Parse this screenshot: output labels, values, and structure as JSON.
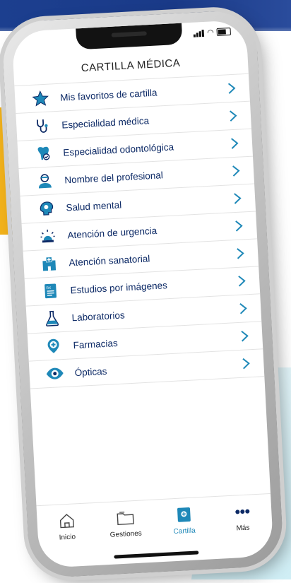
{
  "header": {
    "title": "CARTILLA MÉDICA"
  },
  "menu": {
    "items": [
      {
        "label": "Mis favoritos de cartilla",
        "icon": "star-icon"
      },
      {
        "label": "Especialidad médica",
        "icon": "stethoscope-icon"
      },
      {
        "label": "Especialidad odontológica",
        "icon": "tooth-icon"
      },
      {
        "label": "Nombre del profesional",
        "icon": "doctor-icon"
      },
      {
        "label": "Salud mental",
        "icon": "head-brain-icon"
      },
      {
        "label": "Atención de urgencia",
        "icon": "siren-icon"
      },
      {
        "label": "Atención sanatorial",
        "icon": "hospital-icon"
      },
      {
        "label": "Estudios por imágenes",
        "icon": "rx-document-icon"
      },
      {
        "label": "Laboratorios",
        "icon": "flask-icon"
      },
      {
        "label": "Farmacias",
        "icon": "pharmacy-pin-icon"
      },
      {
        "label": "Ópticas",
        "icon": "eye-icon"
      }
    ]
  },
  "tabbar": {
    "tabs": [
      {
        "label": "Inicio",
        "icon": "home-icon"
      },
      {
        "label": "Gestiones",
        "icon": "folder-icon"
      },
      {
        "label": "Cartilla",
        "icon": "cartilla-book-icon",
        "active": true
      },
      {
        "label": "Más",
        "icon": "more-dots-icon"
      }
    ]
  },
  "colors": {
    "primary": "#0d2a66",
    "icon_blue": "#1e88b8",
    "chevron": "#1e88b8",
    "accent_yellow": "#f2b21b",
    "brand_navy": "#1c3f8f"
  }
}
